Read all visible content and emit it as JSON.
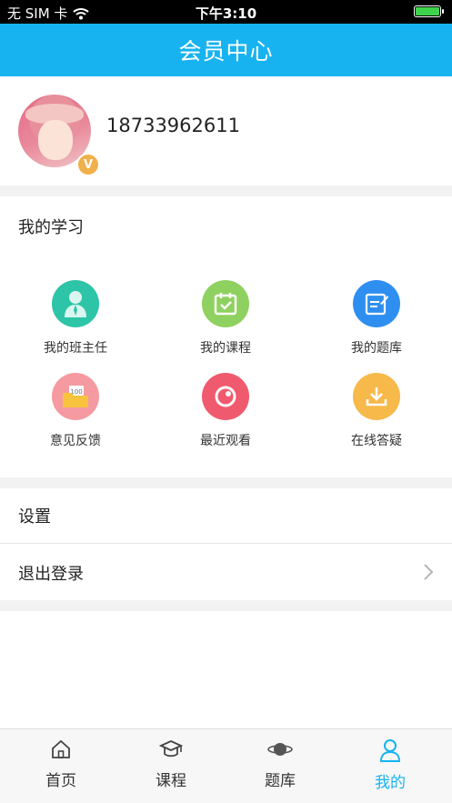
{
  "status_bar": {
    "carrier": "无 SIM 卡",
    "time": "下午3:10"
  },
  "header": {
    "title": "会员中心"
  },
  "profile": {
    "phone": "18733962611",
    "badge": "V"
  },
  "study": {
    "heading": "我的学习",
    "items": [
      {
        "label": "我的班主任",
        "icon": "teacher-icon",
        "color": "#2ec4a8"
      },
      {
        "label": "我的课程",
        "icon": "calendar-check-icon",
        "color": "#8fd160"
      },
      {
        "label": "我的题库",
        "icon": "edit-document-icon",
        "color": "#2f8ff0"
      },
      {
        "label": "意见反馈",
        "icon": "feedback-folder-icon",
        "color": "#f59aa0"
      },
      {
        "label": "最近观看",
        "icon": "recent-view-icon",
        "color": "#f05a6e"
      },
      {
        "label": "在线答疑",
        "icon": "download-icon",
        "color": "#f6b94a"
      }
    ]
  },
  "settings": {
    "settings_label": "设置",
    "logout_label": "退出登录"
  },
  "tabbar": {
    "tabs": [
      {
        "label": "首页",
        "icon": "home-icon"
      },
      {
        "label": "课程",
        "icon": "graduation-cap-icon"
      },
      {
        "label": "题库",
        "icon": "planet-icon"
      },
      {
        "label": "我的",
        "icon": "user-icon",
        "active": true
      }
    ],
    "active_color": "#17b3f0"
  },
  "colors": {
    "accent": "#17b3f0",
    "badge": "#f0b04a"
  }
}
